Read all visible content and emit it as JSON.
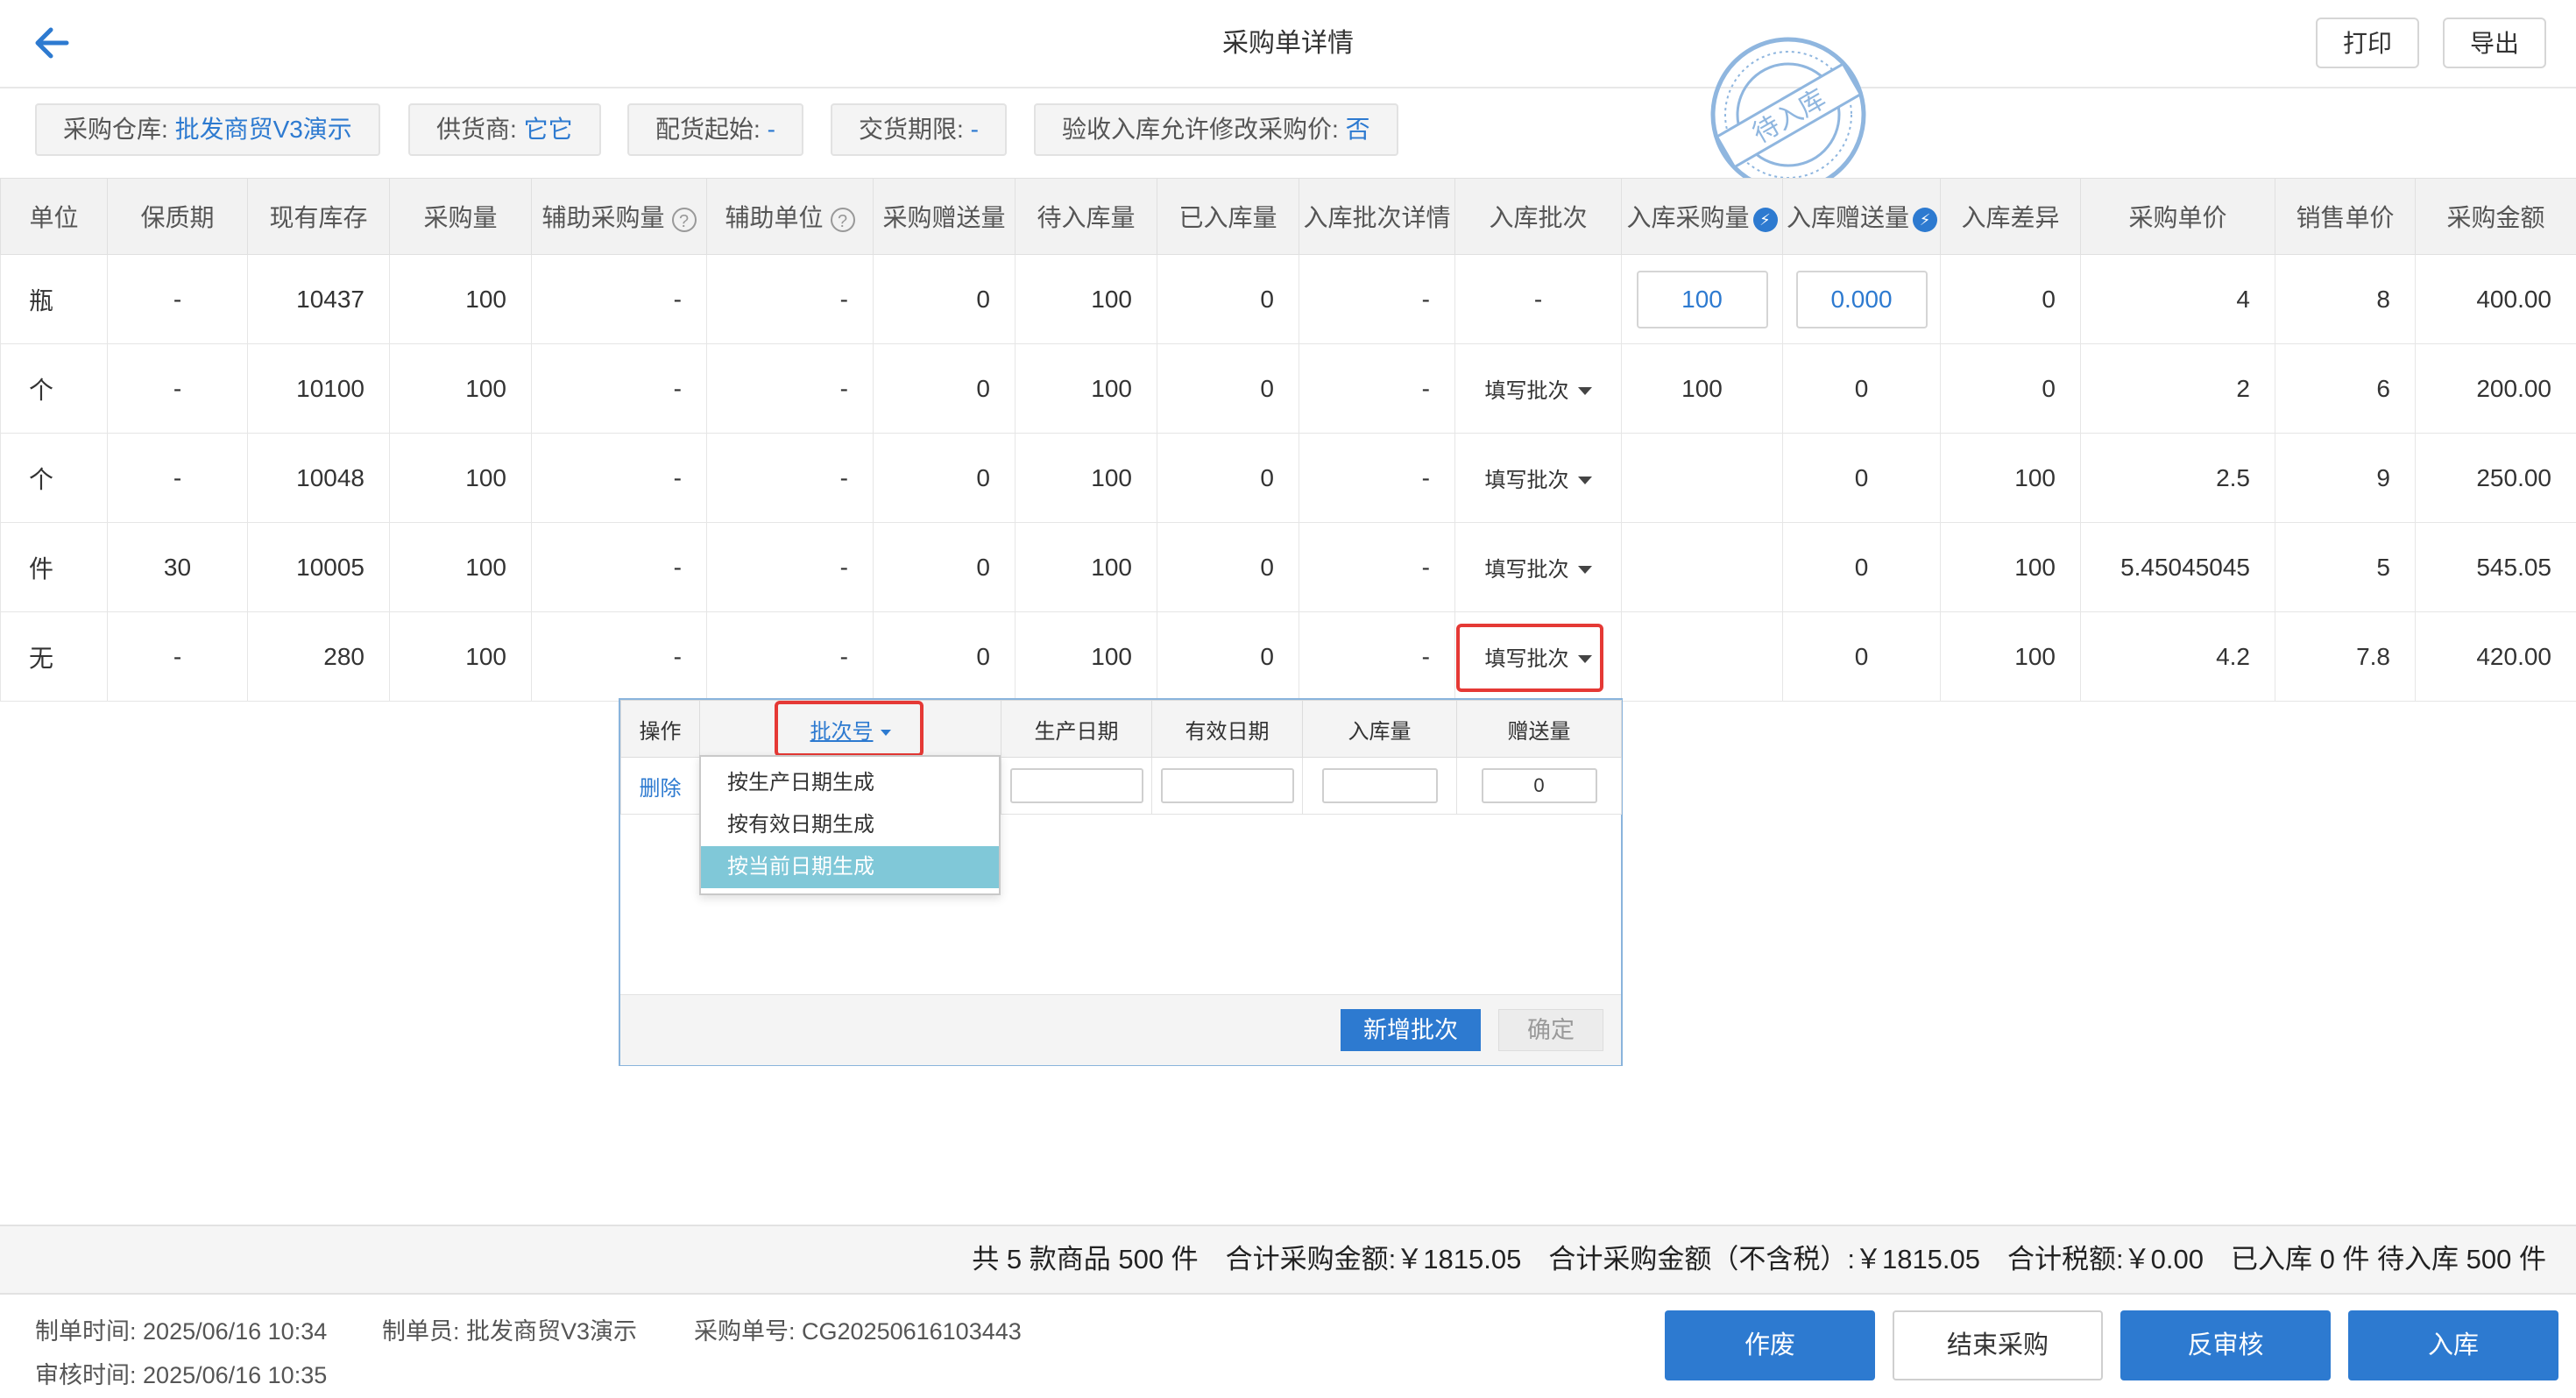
{
  "header": {
    "title": "采购单详情",
    "print_label": "打印",
    "export_label": "导出",
    "stamp_text": "待入库"
  },
  "info_chips": [
    {
      "label": "采购仓库:",
      "value": "批发商贸V3演示"
    },
    {
      "label": "供货商:",
      "value": "它它"
    },
    {
      "label": "配货起始:",
      "value": "-"
    },
    {
      "label": "交货期限:",
      "value": "-"
    },
    {
      "label": "验收入库允许修改采购价:",
      "value": "否"
    }
  ],
  "table": {
    "columns": [
      "单位",
      "保质期",
      "现有库存",
      "采购量",
      "辅助采购量",
      "辅助单位",
      "采购赠送量",
      "待入库量",
      "已入库量",
      "入库批次详情",
      "入库批次",
      "入库采购量",
      "入库赠送量",
      "入库差异",
      "采购单价",
      "销售单价",
      "采购金额"
    ],
    "rows": [
      [
        "瓶",
        "-",
        "10437",
        "100",
        "-",
        "-",
        "0",
        "100",
        "0",
        "-",
        "-",
        "100",
        "0.000",
        "0",
        "4",
        "8",
        "400.00"
      ],
      [
        "个",
        "-",
        "10100",
        "100",
        "-",
        "-",
        "0",
        "100",
        "0",
        "-",
        "填写批次",
        "100",
        "0",
        "0",
        "2",
        "6",
        "200.00"
      ],
      [
        "个",
        "-",
        "10048",
        "100",
        "-",
        "-",
        "0",
        "100",
        "0",
        "-",
        "填写批次",
        "",
        "0",
        "100",
        "2.5",
        "9",
        "250.00"
      ],
      [
        "件",
        "30",
        "10005",
        "100",
        "-",
        "-",
        "0",
        "100",
        "0",
        "-",
        "填写批次",
        "",
        "0",
        "100",
        "5.45045045",
        "5",
        "545.05"
      ],
      [
        "无",
        "-",
        "280",
        "100",
        "-",
        "-",
        "0",
        "100",
        "0",
        "-",
        "填写批次",
        "",
        "0",
        "100",
        "4.2",
        "7.8",
        "420.00"
      ]
    ]
  },
  "batch_popup": {
    "columns": [
      "操作",
      "批次号",
      "生产日期",
      "有效日期",
      "入库量",
      "赠送量"
    ],
    "row": {
      "action": "删除",
      "gift_qty": "0"
    },
    "dropdown": [
      "按生产日期生成",
      "按有效日期生成",
      "按当前日期生成"
    ],
    "selected_option": "按当前日期生成",
    "add_label": "新增批次",
    "confirm_label": "确定"
  },
  "summary": {
    "text": "共 5 款商品 500 件　合计采购金额:￥1815.05　合计采购金额（不含税）:￥1815.05　合计税额:￥0.00　已入库 0 件 待入库 500 件"
  },
  "meta": {
    "created_label": "制单时间:",
    "created": "2025/06/16 10:34",
    "creator_label": "制单员:",
    "creator": "批发商贸V3演示",
    "order_label": "采购单号:",
    "order_no": "CG20250616103443",
    "audit_label": "审核时间:",
    "audited": "2025/06/16 10:35"
  },
  "actions": {
    "void": "作废",
    "end": "结束采购",
    "unaudit": "反审核",
    "stock_in": "入库"
  },
  "colors": {
    "primary": "#2d7ad0",
    "danger": "#e8231b",
    "highlight": "#e53935"
  }
}
